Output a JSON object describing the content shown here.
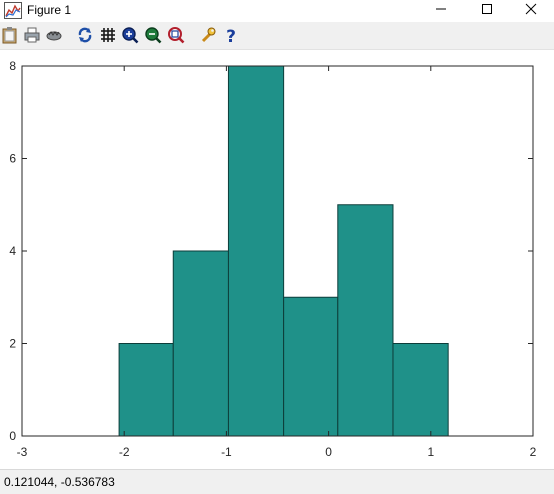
{
  "window": {
    "title": "Figure 1",
    "icon": "figure-plot-icon",
    "controls": [
      "minimize-icon",
      "maximize-icon",
      "close-icon"
    ]
  },
  "toolbar": {
    "buttons": [
      {
        "name": "copy-clipboard-button",
        "icon": "clipboard-icon"
      },
      {
        "name": "print-button",
        "icon": "printer-icon"
      },
      {
        "name": "pan-button",
        "icon": "hand-pan-icon"
      },
      {
        "name": "rotate-button",
        "icon": "rotate-icon"
      },
      {
        "name": "grid-button",
        "icon": "grid-icon"
      },
      {
        "name": "zoom-in-button",
        "icon": "zoom-in-icon"
      },
      {
        "name": "zoom-out-button",
        "icon": "zoom-out-icon"
      },
      {
        "name": "autoscale-button",
        "icon": "autoscale-icon"
      },
      {
        "name": "properties-button",
        "icon": "wrench-icon"
      },
      {
        "name": "help-button",
        "icon": "help-icon"
      }
    ]
  },
  "status": {
    "coordinates": "0.121044, -0.536783"
  },
  "chart_data": {
    "type": "bar",
    "style": "histogram",
    "bar_color": "#1f9189",
    "edge_color": "#0d3d3a",
    "bins": [
      {
        "x_start": -2.05,
        "x_end": -1.52,
        "count": 2
      },
      {
        "x_start": -1.52,
        "x_end": -0.98,
        "count": 4
      },
      {
        "x_start": -0.98,
        "x_end": -0.44,
        "count": 8
      },
      {
        "x_start": -0.44,
        "x_end": 0.09,
        "count": 3
      },
      {
        "x_start": 0.09,
        "x_end": 0.63,
        "count": 5
      },
      {
        "x_start": 0.63,
        "x_end": 1.17,
        "count": 2
      }
    ],
    "xlim": [
      -3,
      2
    ],
    "ylim": [
      0,
      8
    ],
    "xticks": [
      "-3",
      "-2",
      "-1",
      "0",
      "1",
      "2"
    ],
    "yticks": [
      "0",
      "2",
      "4",
      "6",
      "8"
    ],
    "title": "",
    "xlabel": "",
    "ylabel": "",
    "grid": false
  }
}
